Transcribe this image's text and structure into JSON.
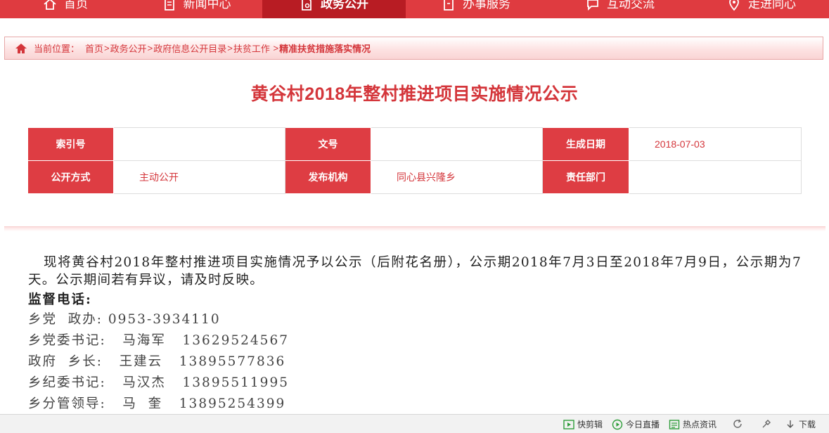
{
  "nav": {
    "items": [
      {
        "label": "首页",
        "icon": "home-icon"
      },
      {
        "label": "新闻中心",
        "icon": "document-icon"
      },
      {
        "label": "政务公开",
        "icon": "file-gear-icon",
        "active": true
      },
      {
        "label": "办事服务",
        "icon": "clipboard-icon"
      },
      {
        "label": "互动交流",
        "icon": "chat-icon"
      },
      {
        "label": "走进同心",
        "icon": "location-pin-icon"
      }
    ]
  },
  "breadcrumb": {
    "prefix": "当前位置：",
    "items": [
      "首页",
      "政务公开",
      "政府信息公开目录",
      "扶贫工作"
    ],
    "current": "精准扶贫措施落实情况"
  },
  "page": {
    "title": "黄谷村2018年整村推进项目实施情况公示"
  },
  "meta": {
    "index_label": "索引号",
    "index_value": "",
    "docno_label": "文号",
    "docno_value": "",
    "date_label": "生成日期",
    "date_value": "2018-07-03",
    "mode_label": "公开方式",
    "mode_value": "主动公开",
    "org_label": "发布机构",
    "org_value": "同心县兴隆乡",
    "dept_label": "责任部门",
    "dept_value": ""
  },
  "content": {
    "paragraph": "现将黄谷村2018年整村推进项目实施情况予以公示（后附花名册），公示期2018年7月3日至2018年7月9日，公示期为7天。公示期间若有异议，请及时反映。",
    "supervision_heading": "监督电话:",
    "lines": [
      "乡党  政办: 0953-3934110",
      "乡党委书记:   马海军   13629524567",
      "政府  乡长:   王建云   13895577836",
      "乡纪委书记:   马汉杰   13895511995",
      "乡分管领导:   马  奎   13895254399"
    ]
  },
  "statusbar": {
    "items": [
      {
        "label": "快剪辑",
        "icon": "video-icon"
      },
      {
        "label": "今日直播",
        "icon": "play-icon"
      },
      {
        "label": "热点资讯",
        "icon": "news-icon"
      },
      {
        "label": "",
        "icon": "refresh-icon"
      },
      {
        "label": "",
        "icon": "tools-icon"
      },
      {
        "label": "下载",
        "icon": "download-icon"
      }
    ]
  }
}
